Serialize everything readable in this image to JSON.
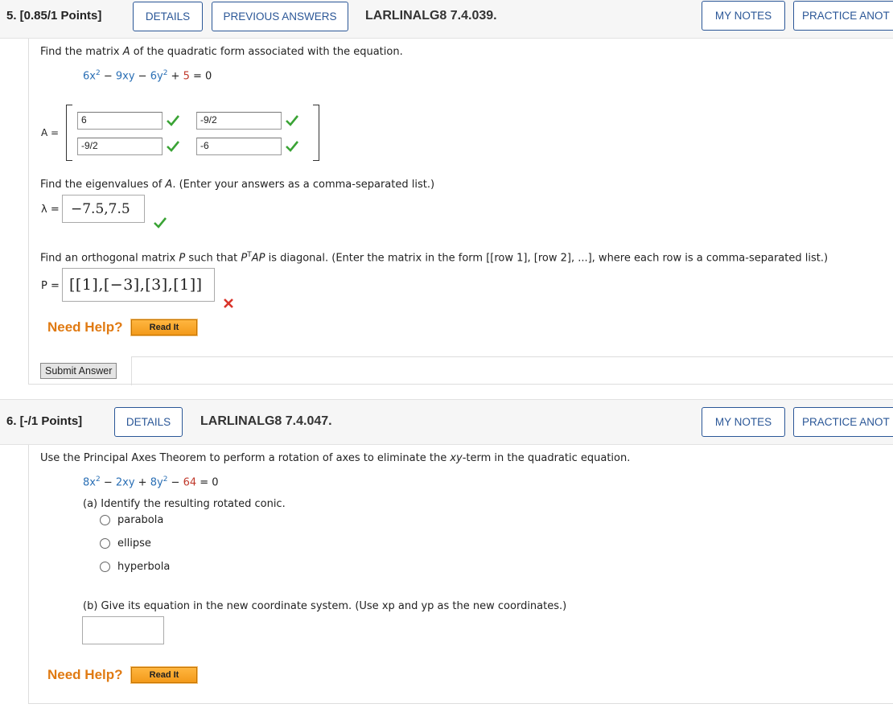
{
  "q5": {
    "number": "5. [0.85/1 Points]",
    "details_label": "DETAILS",
    "previous_answers_label": "PREVIOUS ANSWERS",
    "code": "LARLINALG8 7.4.039.",
    "my_notes_label": "MY NOTES",
    "practice_label": "PRACTICE ANOT",
    "prompt_pre": "Find the matrix ",
    "prompt_var": "A",
    "prompt_post": " of the quadratic form associated with the equation.",
    "equation": {
      "t1": "6x",
      "t1_exp": "2",
      "op1": " − ",
      "t2": "9xy",
      "op2": " − ",
      "t3": "6y",
      "t3_exp": "2",
      "op3": " + ",
      "t4": "5",
      "eq": " = 0"
    },
    "matrix_label": "A =",
    "matrix": {
      "a11": "6",
      "a12": "-9/2",
      "a21": "-9/2",
      "a22": "-6"
    },
    "eigen_prompt_pre": "Find the eigenvalues of ",
    "eigen_prompt_var": "A",
    "eigen_prompt_post": ". (Enter your answers as a comma-separated list.)",
    "lambda_label": "λ =",
    "lambda_value": "−7.5,7.5",
    "orth_prompt_pre": "Find an orthogonal matrix ",
    "orth_prompt_P": "P",
    "orth_prompt_mid": " such that ",
    "orth_prompt_PTAP": "P",
    "orth_prompt_T": "T",
    "orth_prompt_AP": "AP",
    "orth_prompt_post": " is diagonal. (Enter the matrix in the form [[row 1], [row 2], ...], where each row is a comma-separated list.)",
    "p_label": "P =",
    "p_value": "[[1],[−3],[3],[1]]",
    "need_help": "Need Help?",
    "read_it": "Read It",
    "submit_label": "Submit Answer"
  },
  "q6": {
    "number": "6. [-/1 Points]",
    "details_label": "DETAILS",
    "code": "LARLINALG8 7.4.047.",
    "my_notes_label": "MY NOTES",
    "practice_label": "PRACTICE ANOT",
    "prompt_pre": "Use the Principal Axes Theorem to perform a rotation of axes to eliminate the ",
    "prompt_var": "xy",
    "prompt_post": "-term in the quadratic equation.",
    "equation": {
      "t1": "8x",
      "t1_exp": "2",
      "op1": " − ",
      "t2": "2xy",
      "op2": " + ",
      "t3": "8y",
      "t3_exp": "2",
      "op3": " − ",
      "t4": "64",
      "eq": " = 0"
    },
    "part_a": "(a) Identify the resulting rotated conic.",
    "options": [
      "parabola",
      "ellipse",
      "hyperbola"
    ],
    "part_b": "(b) Give its equation in the new coordinate system. (Use xp and yp as the new coordinates.)",
    "part_b_value": "",
    "need_help": "Need Help?",
    "read_it": "Read It"
  },
  "colors": {
    "accent": "#2b5797",
    "correct": "#3aa335",
    "incorrect": "#d9342b",
    "help": "#e07a12"
  }
}
